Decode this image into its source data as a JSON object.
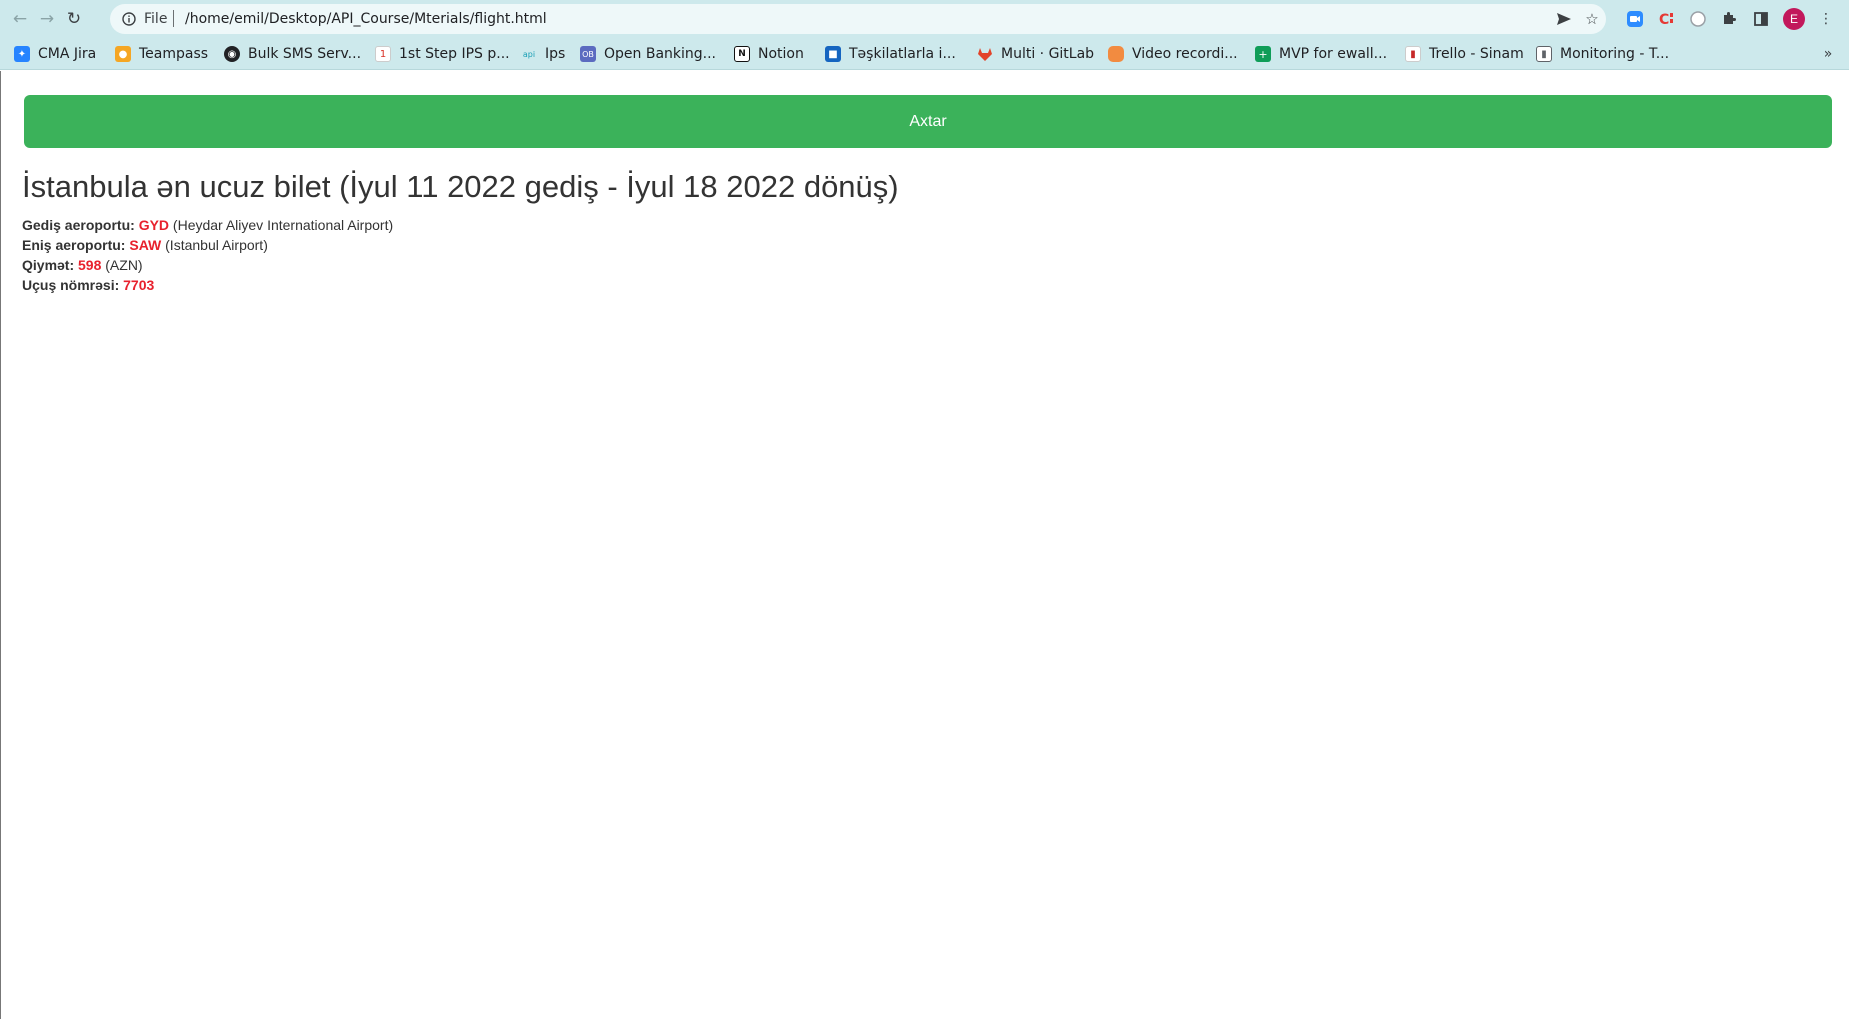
{
  "browser": {
    "scheme_label": "File",
    "url": "/home/emil/Desktop/API_Course/Mterials/flight.html",
    "profile_initial": "E",
    "bookmarks": [
      {
        "label": "CMA Jira",
        "icon": "jira-icon",
        "color": "#2684ff"
      },
      {
        "label": "Teampass",
        "icon": "teampass-icon",
        "color": "#f5a623"
      },
      {
        "label": "Bulk SMS Serv...",
        "icon": "globe-icon",
        "color": "#202124"
      },
      {
        "label": "1st Step IPS p...",
        "icon": "ips-icon",
        "color": "#d93025"
      },
      {
        "label": "Ips",
        "icon": "api-pay-icon",
        "color": "#1a9fb5"
      },
      {
        "label": "Open Banking...",
        "icon": "ob-icon",
        "color": "#5b6bc0"
      },
      {
        "label": "Notion",
        "icon": "notion-icon",
        "color": "#111111"
      },
      {
        "label": "Təşkilatlarla i...",
        "icon": "tasks-icon",
        "color": "#1565c0"
      },
      {
        "label": "Multi · GitLab",
        "icon": "gitlab-icon",
        "color": "#e24329"
      },
      {
        "label": "Video recordi...",
        "icon": "video-icon",
        "color": "#f28b40"
      },
      {
        "label": "MVP for ewall...",
        "icon": "sheets-icon",
        "color": "#0f9d58"
      },
      {
        "label": "Trello - Sinam",
        "icon": "trello-icon",
        "color": "#c62828"
      },
      {
        "label": "Monitoring - T...",
        "icon": "monitoring-icon",
        "color": "#5f6368"
      }
    ]
  },
  "page": {
    "search_button": "Axtar",
    "title": "İstanbula ən ucuz bilet (İyul 11 2022 gediş - İyul 18 2022 dönüş)",
    "rows": {
      "departure": {
        "label": "Gediş aeroportu:",
        "code": "GYD",
        "detail": "(Heydar Aliyev International Airport)"
      },
      "arrival": {
        "label": "Eniş aeroportu:",
        "code": "SAW",
        "detail": "(Istanbul Airport)"
      },
      "price": {
        "label": "Qiymət:",
        "value": "598",
        "detail": "(AZN)"
      },
      "flight": {
        "label": "Uçuş nömrəsi:",
        "value": "7703"
      }
    },
    "colors": {
      "button": "#3bb25a",
      "highlight": "#e8212d",
      "text": "#333333"
    }
  }
}
